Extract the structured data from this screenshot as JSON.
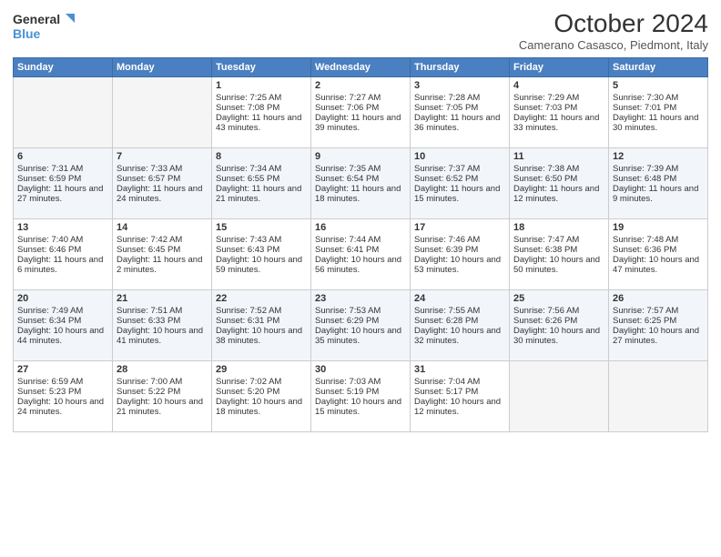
{
  "header": {
    "logo_line1": "General",
    "logo_line2": "Blue",
    "month": "October 2024",
    "location": "Camerano Casasco, Piedmont, Italy"
  },
  "days_of_week": [
    "Sunday",
    "Monday",
    "Tuesday",
    "Wednesday",
    "Thursday",
    "Friday",
    "Saturday"
  ],
  "weeks": [
    [
      {
        "num": "",
        "sunrise": "",
        "sunset": "",
        "daylight": "",
        "empty": true
      },
      {
        "num": "",
        "sunrise": "",
        "sunset": "",
        "daylight": "",
        "empty": true
      },
      {
        "num": "1",
        "sunrise": "Sunrise: 7:25 AM",
        "sunset": "Sunset: 7:08 PM",
        "daylight": "Daylight: 11 hours and 43 minutes."
      },
      {
        "num": "2",
        "sunrise": "Sunrise: 7:27 AM",
        "sunset": "Sunset: 7:06 PM",
        "daylight": "Daylight: 11 hours and 39 minutes."
      },
      {
        "num": "3",
        "sunrise": "Sunrise: 7:28 AM",
        "sunset": "Sunset: 7:05 PM",
        "daylight": "Daylight: 11 hours and 36 minutes."
      },
      {
        "num": "4",
        "sunrise": "Sunrise: 7:29 AM",
        "sunset": "Sunset: 7:03 PM",
        "daylight": "Daylight: 11 hours and 33 minutes."
      },
      {
        "num": "5",
        "sunrise": "Sunrise: 7:30 AM",
        "sunset": "Sunset: 7:01 PM",
        "daylight": "Daylight: 11 hours and 30 minutes."
      }
    ],
    [
      {
        "num": "6",
        "sunrise": "Sunrise: 7:31 AM",
        "sunset": "Sunset: 6:59 PM",
        "daylight": "Daylight: 11 hours and 27 minutes."
      },
      {
        "num": "7",
        "sunrise": "Sunrise: 7:33 AM",
        "sunset": "Sunset: 6:57 PM",
        "daylight": "Daylight: 11 hours and 24 minutes."
      },
      {
        "num": "8",
        "sunrise": "Sunrise: 7:34 AM",
        "sunset": "Sunset: 6:55 PM",
        "daylight": "Daylight: 11 hours and 21 minutes."
      },
      {
        "num": "9",
        "sunrise": "Sunrise: 7:35 AM",
        "sunset": "Sunset: 6:54 PM",
        "daylight": "Daylight: 11 hours and 18 minutes."
      },
      {
        "num": "10",
        "sunrise": "Sunrise: 7:37 AM",
        "sunset": "Sunset: 6:52 PM",
        "daylight": "Daylight: 11 hours and 15 minutes."
      },
      {
        "num": "11",
        "sunrise": "Sunrise: 7:38 AM",
        "sunset": "Sunset: 6:50 PM",
        "daylight": "Daylight: 11 hours and 12 minutes."
      },
      {
        "num": "12",
        "sunrise": "Sunrise: 7:39 AM",
        "sunset": "Sunset: 6:48 PM",
        "daylight": "Daylight: 11 hours and 9 minutes."
      }
    ],
    [
      {
        "num": "13",
        "sunrise": "Sunrise: 7:40 AM",
        "sunset": "Sunset: 6:46 PM",
        "daylight": "Daylight: 11 hours and 6 minutes."
      },
      {
        "num": "14",
        "sunrise": "Sunrise: 7:42 AM",
        "sunset": "Sunset: 6:45 PM",
        "daylight": "Daylight: 11 hours and 2 minutes."
      },
      {
        "num": "15",
        "sunrise": "Sunrise: 7:43 AM",
        "sunset": "Sunset: 6:43 PM",
        "daylight": "Daylight: 10 hours and 59 minutes."
      },
      {
        "num": "16",
        "sunrise": "Sunrise: 7:44 AM",
        "sunset": "Sunset: 6:41 PM",
        "daylight": "Daylight: 10 hours and 56 minutes."
      },
      {
        "num": "17",
        "sunrise": "Sunrise: 7:46 AM",
        "sunset": "Sunset: 6:39 PM",
        "daylight": "Daylight: 10 hours and 53 minutes."
      },
      {
        "num": "18",
        "sunrise": "Sunrise: 7:47 AM",
        "sunset": "Sunset: 6:38 PM",
        "daylight": "Daylight: 10 hours and 50 minutes."
      },
      {
        "num": "19",
        "sunrise": "Sunrise: 7:48 AM",
        "sunset": "Sunset: 6:36 PM",
        "daylight": "Daylight: 10 hours and 47 minutes."
      }
    ],
    [
      {
        "num": "20",
        "sunrise": "Sunrise: 7:49 AM",
        "sunset": "Sunset: 6:34 PM",
        "daylight": "Daylight: 10 hours and 44 minutes."
      },
      {
        "num": "21",
        "sunrise": "Sunrise: 7:51 AM",
        "sunset": "Sunset: 6:33 PM",
        "daylight": "Daylight: 10 hours and 41 minutes."
      },
      {
        "num": "22",
        "sunrise": "Sunrise: 7:52 AM",
        "sunset": "Sunset: 6:31 PM",
        "daylight": "Daylight: 10 hours and 38 minutes."
      },
      {
        "num": "23",
        "sunrise": "Sunrise: 7:53 AM",
        "sunset": "Sunset: 6:29 PM",
        "daylight": "Daylight: 10 hours and 35 minutes."
      },
      {
        "num": "24",
        "sunrise": "Sunrise: 7:55 AM",
        "sunset": "Sunset: 6:28 PM",
        "daylight": "Daylight: 10 hours and 32 minutes."
      },
      {
        "num": "25",
        "sunrise": "Sunrise: 7:56 AM",
        "sunset": "Sunset: 6:26 PM",
        "daylight": "Daylight: 10 hours and 30 minutes."
      },
      {
        "num": "26",
        "sunrise": "Sunrise: 7:57 AM",
        "sunset": "Sunset: 6:25 PM",
        "daylight": "Daylight: 10 hours and 27 minutes."
      }
    ],
    [
      {
        "num": "27",
        "sunrise": "Sunrise: 6:59 AM",
        "sunset": "Sunset: 5:23 PM",
        "daylight": "Daylight: 10 hours and 24 minutes."
      },
      {
        "num": "28",
        "sunrise": "Sunrise: 7:00 AM",
        "sunset": "Sunset: 5:22 PM",
        "daylight": "Daylight: 10 hours and 21 minutes."
      },
      {
        "num": "29",
        "sunrise": "Sunrise: 7:02 AM",
        "sunset": "Sunset: 5:20 PM",
        "daylight": "Daylight: 10 hours and 18 minutes."
      },
      {
        "num": "30",
        "sunrise": "Sunrise: 7:03 AM",
        "sunset": "Sunset: 5:19 PM",
        "daylight": "Daylight: 10 hours and 15 minutes."
      },
      {
        "num": "31",
        "sunrise": "Sunrise: 7:04 AM",
        "sunset": "Sunset: 5:17 PM",
        "daylight": "Daylight: 10 hours and 12 minutes."
      },
      {
        "num": "",
        "sunrise": "",
        "sunset": "",
        "daylight": "",
        "empty": true
      },
      {
        "num": "",
        "sunrise": "",
        "sunset": "",
        "daylight": "",
        "empty": true
      }
    ]
  ]
}
